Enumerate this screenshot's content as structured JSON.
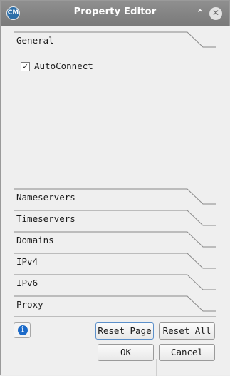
{
  "window": {
    "title": "Property Editor",
    "app_icon_text": "CM"
  },
  "sections": {
    "general": "General",
    "nameservers": "Nameservers",
    "timeservers": "Timeservers",
    "domains": "Domains",
    "ipv4": "IPv4",
    "ipv6": "IPv6",
    "proxy": "Proxy"
  },
  "general_pane": {
    "autoconnect_label": "AutoConnect",
    "autoconnect_checked": true,
    "check_glyph": "✓"
  },
  "buttons": {
    "reset_page": "Reset Page",
    "reset_all": "Reset All",
    "ok": "OK",
    "cancel": "Cancel",
    "info": "i"
  },
  "titlebar_controls": {
    "minimize": "⌃",
    "close": "✕"
  }
}
